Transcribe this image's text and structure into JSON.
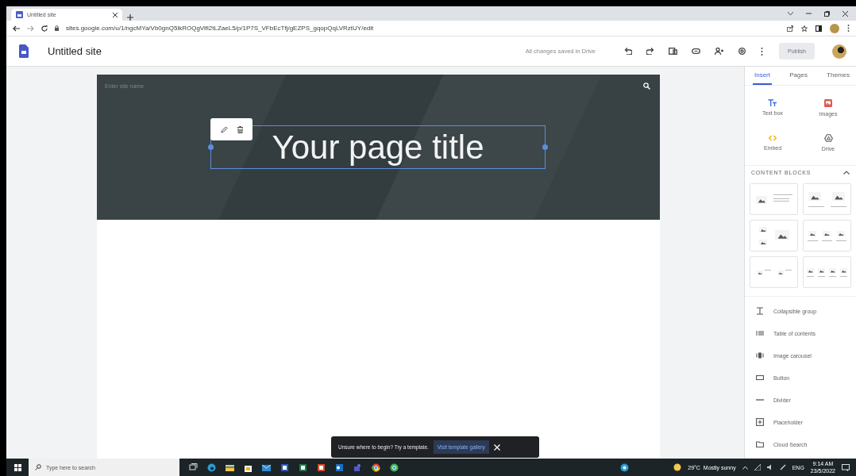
{
  "browser": {
    "tab_title": "Untitled site",
    "url": "sites.google.com/u/1/ngcMYa/Vb0gnQ5lkROQgVifl2tLZaeL5/p/1P7S_VFbEcTfj/gEZPS_gqopQqLVRztUY/edit"
  },
  "app_bar": {
    "site_title": "Untitled site",
    "save_status": "All changes saved in Drive",
    "publish_button": {
      "label": "Publish",
      "disabled": true
    }
  },
  "canvas": {
    "site_name_placeholder": "Enter site name",
    "page_title": "Your page title"
  },
  "panel": {
    "tabs": [
      {
        "label": "Insert",
        "selected": true
      },
      {
        "label": "Pages",
        "selected": false
      },
      {
        "label": "Themes",
        "selected": false
      }
    ],
    "insert_items": [
      {
        "label": "Text box",
        "kind": "textbox"
      },
      {
        "label": "Images",
        "kind": "images"
      },
      {
        "label": "Embed",
        "kind": "embed"
      },
      {
        "label": "Drive",
        "kind": "drive"
      }
    ],
    "content_blocks_heading": "CONTENT BLOCKS",
    "content_blocks_expanded": true,
    "content_blocks": [
      {
        "kind": "image-text"
      },
      {
        "kind": "two-images"
      },
      {
        "kind": "image-grid"
      },
      {
        "kind": "three-columns"
      },
      {
        "kind": "two-image-text"
      },
      {
        "kind": "four-columns"
      }
    ],
    "components": [
      {
        "label": "Collapsible group",
        "kind": "collapsible"
      },
      {
        "label": "Table of contents",
        "kind": "toc"
      },
      {
        "label": "Image carousel",
        "kind": "carousel"
      },
      {
        "label": "Button",
        "kind": "button"
      },
      {
        "label": "Divider",
        "kind": "divider"
      },
      {
        "label": "Placeholder",
        "kind": "placeholder"
      },
      {
        "label": "Cloud Search",
        "kind": "cloud-search"
      }
    ]
  },
  "snackbar": {
    "message": "Unsure where to begin? Try a template.",
    "action": "Visit template gallery"
  },
  "taskbar": {
    "search_placeholder": "Type here to search",
    "weather": "29°C  Mostly sunny",
    "language": "ENG",
    "time": "9:14 AM",
    "date": "23/5/2022"
  }
}
